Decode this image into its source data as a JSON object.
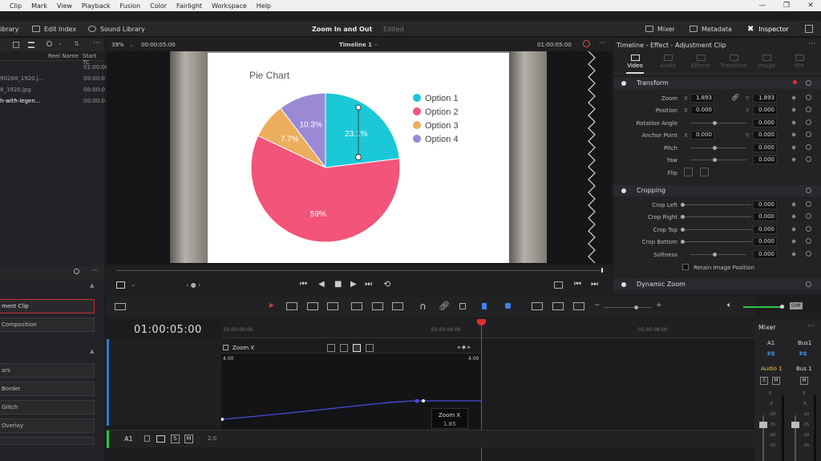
{
  "menu": [
    "Clip",
    "Mark",
    "View",
    "Playback",
    "Fusion",
    "Color",
    "Fairlight",
    "Workspace",
    "Help"
  ],
  "window_controls": [
    "—",
    "❐",
    "✕"
  ],
  "toolbar": {
    "media_library": "ibrary",
    "edit_index": "Edit Index",
    "sound_library": "Sound Library",
    "project_title": "Zoom In and Out",
    "edited": "Edited",
    "mixer": "Mixer",
    "metadata": "Metadata",
    "inspector": "Inspector"
  },
  "media_pool": {
    "columns": [
      "Reel Name",
      "Start TC"
    ],
    "rows": [
      {
        "name": "",
        "tc": "01:00:00"
      },
      {
        "name": "90268_1920.j...",
        "tc": "00:00:0"
      },
      {
        "name": "8_1920.jpg",
        "tc": "00:00:0"
      },
      {
        "name": "h-with-legen...",
        "tc": "00:00:0"
      }
    ]
  },
  "viewer": {
    "zoom": "39%",
    "source_tc": "00:00:05:00",
    "timeline_name": "Timeline 1",
    "current_tc": "01:00:05:00"
  },
  "chart_data": {
    "type": "pie",
    "title": "Pie Chart",
    "labels": [
      "Option 1",
      "Option 2",
      "Option 3",
      "Option 4"
    ],
    "values": [
      23.1,
      59,
      7.7,
      10.3
    ],
    "value_labels": [
      "23.1%",
      "59%",
      "7.7%",
      "10.3%"
    ],
    "colors": [
      "#1ac8d8",
      "#f2547a",
      "#ecae5c",
      "#9a8ad6"
    ],
    "legend_position": "right"
  },
  "inspector": {
    "title": "Timeline - Effect - Adjustment Clip",
    "tabs": [
      "Video",
      "Audio",
      "Effects",
      "Transition",
      "Image",
      "File"
    ],
    "transform_header": "Transform",
    "zoom_label": "Zoom",
    "zoom_x": "1.893",
    "zoom_y": "1.893",
    "position_label": "Position",
    "position_x": "0.000",
    "position_y": "0.000",
    "rotation_label": "Rotation Angle",
    "rotation": "0.000",
    "anchor_label": "Anchor Point",
    "anchor_x": "0.000",
    "anchor_y": "0.000",
    "pitch_label": "Pitch",
    "pitch": "0.000",
    "yaw_label": "Yaw",
    "yaw": "0.000",
    "flip_label": "Flip",
    "x": "X",
    "y": "Y",
    "cropping_header": "Cropping",
    "crop_left_label": "Crop Left",
    "crop_left": "0.000",
    "crop_right_label": "Crop Right",
    "crop_right": "0.000",
    "crop_top_label": "Crop Top",
    "crop_top": "0.000",
    "crop_bottom_label": "Crop Bottom",
    "crop_bottom": "0.000",
    "softness_label": "Softness",
    "softness": "0.000",
    "retain_label": "Retain Image Position",
    "dynamic_zoom_header": "Dynamic Zoom"
  },
  "effects_list": {
    "items": [
      "ment Clip",
      "Composition"
    ],
    "items2": [
      "ars",
      "Border",
      "Glitch",
      "Overlay"
    ]
  },
  "timeline": {
    "timecode": "01:00:05:00",
    "ruler": [
      "01:00:00:00",
      "01:00:04:00",
      "01:00:08:00"
    ],
    "curve_label": "Zoom X",
    "curve_left_value": "4.00",
    "curve_right_value": "4.00",
    "tooltip_title": "Zoom X",
    "tooltip_value": "1.85",
    "track_a1": "A1",
    "track_level": "2.0",
    "s": "S",
    "m": "M"
  },
  "mixer": {
    "title": "Mixer",
    "ch1": "A1",
    "ch2": "Bus1",
    "eq": "EQ",
    "audio1": "Audio 1",
    "bus1": "Bus 1",
    "scale": [
      "0",
      "-5",
      "-10",
      "-15",
      "-20",
      "-25"
    ],
    "s": "S",
    "m": "M"
  },
  "edit_toolbar": {
    "dim": "DIM"
  }
}
